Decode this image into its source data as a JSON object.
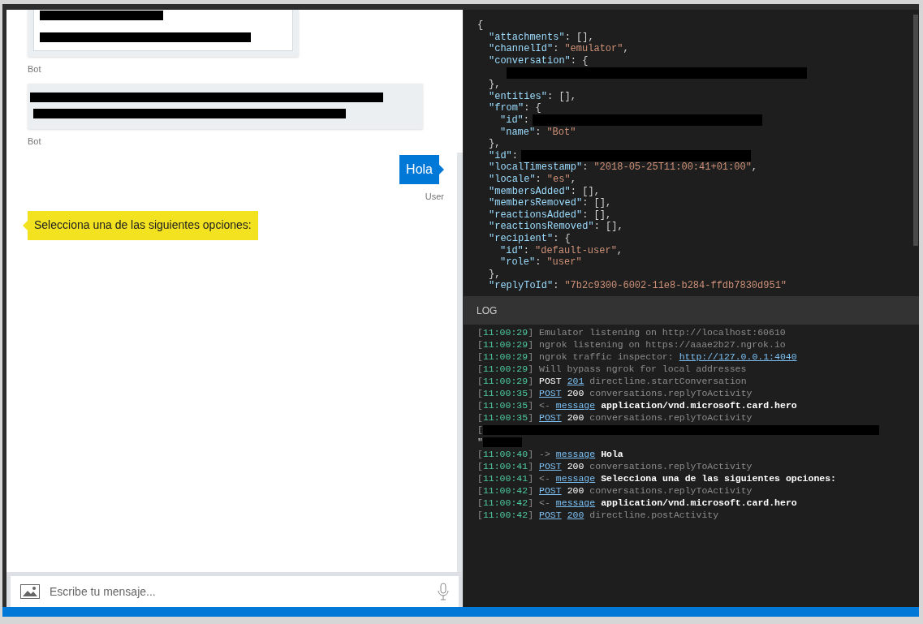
{
  "chat": {
    "messages": [
      {
        "kind": "card",
        "sender": "Bot",
        "selected": false
      },
      {
        "kind": "redacted",
        "sender": "Bot",
        "selected": false
      },
      {
        "kind": "user-text",
        "text": "Hola",
        "sender": "User",
        "selected": false
      },
      {
        "kind": "bot-text",
        "text": "Selecciona una de las siguientes opciones:",
        "selected": true
      }
    ],
    "input": {
      "placeholder": "Escribe tu mensaje..."
    }
  },
  "inspector": {
    "lines": [
      {
        "t": [
          {
            "kind": "punct",
            "text": "{"
          }
        ],
        "children": [
          {
            "t": [
              {
                "kind": "key",
                "text": "\"attachments\""
              },
              {
                "kind": "punct",
                "text": ": [],"
              }
            ]
          },
          {
            "t": [
              {
                "kind": "key",
                "text": "\"channelId\""
              },
              {
                "kind": "punct",
                "text": ":"
              },
              {
                "kind": "string",
                "text": "\"emulator\""
              },
              {
                "kind": "punct",
                "text": ","
              }
            ]
          },
          {
            "t": [
              {
                "kind": "key",
                "text": "\"conversation\""
              },
              {
                "kind": "punct",
                "text": ": {"
              }
            ],
            "close": [
              {
                "kind": "punct",
                "text": "},"
              }
            ],
            "children": [
              {
                "t": [
                  {
                    "kind": "redacted-long"
                  }
                ]
              }
            ]
          },
          {
            "t": [
              {
                "kind": "key",
                "text": "\"entities\""
              },
              {
                "kind": "punct",
                "text": ": [],"
              }
            ]
          },
          {
            "t": [
              {
                "kind": "key",
                "text": "\"from\""
              },
              {
                "kind": "punct",
                "text": ": {"
              }
            ],
            "close": [
              {
                "kind": "punct",
                "text": "},"
              }
            ],
            "children": [
              {
                "t": [
                  {
                    "kind": "key",
                    "text": "\"id\""
                  },
                  {
                    "kind": "punct",
                    "text": ":"
                  },
                  {
                    "kind": "redacted"
                  }
                ]
              },
              {
                "t": [
                  {
                    "kind": "key",
                    "text": "\"name\""
                  },
                  {
                    "kind": "punct",
                    "text": ":"
                  },
                  {
                    "kind": "string",
                    "text": "\"Bot\""
                  }
                ]
              }
            ]
          },
          {
            "t": [
              {
                "kind": "key",
                "text": "\"id\""
              },
              {
                "kind": "punct",
                "text": ":"
              },
              {
                "kind": "redacted"
              }
            ]
          },
          {
            "t": [
              {
                "kind": "key",
                "text": "\"localTimestamp\""
              },
              {
                "kind": "punct",
                "text": ":"
              },
              {
                "kind": "string",
                "text": "\"2018-05-25T11:00:41+01:00\""
              },
              {
                "kind": "punct",
                "text": ","
              }
            ]
          },
          {
            "t": [
              {
                "kind": "key",
                "text": "\"locale\""
              },
              {
                "kind": "punct",
                "text": ":"
              },
              {
                "kind": "string",
                "text": "\"es\""
              },
              {
                "kind": "punct",
                "text": ","
              }
            ]
          },
          {
            "t": [
              {
                "kind": "key",
                "text": "\"membersAdded\""
              },
              {
                "kind": "punct",
                "text": ": [],"
              }
            ]
          },
          {
            "t": [
              {
                "kind": "key",
                "text": "\"membersRemoved\""
              },
              {
                "kind": "punct",
                "text": ": [],"
              }
            ]
          },
          {
            "t": [
              {
                "kind": "key",
                "text": "\"reactionsAdded\""
              },
              {
                "kind": "punct",
                "text": ": [],"
              }
            ]
          },
          {
            "t": [
              {
                "kind": "key",
                "text": "\"reactionsRemoved\""
              },
              {
                "kind": "punct",
                "text": ": [],"
              }
            ]
          },
          {
            "t": [
              {
                "kind": "key",
                "text": "\"recipient\""
              },
              {
                "kind": "punct",
                "text": ": {"
              }
            ],
            "close": [
              {
                "kind": "punct",
                "text": "},"
              }
            ],
            "children": [
              {
                "t": [
                  {
                    "kind": "key",
                    "text": "\"id\""
                  },
                  {
                    "kind": "punct",
                    "text": ":"
                  },
                  {
                    "kind": "string",
                    "text": "\"default-user\""
                  },
                  {
                    "kind": "punct",
                    "text": ","
                  }
                ]
              },
              {
                "t": [
                  {
                    "kind": "key",
                    "text": "\"role\""
                  },
                  {
                    "kind": "punct",
                    "text": ":"
                  },
                  {
                    "kind": "string",
                    "text": "\"user\""
                  }
                ]
              }
            ]
          },
          {
            "t": [
              {
                "kind": "key",
                "text": "\"replyToId\""
              },
              {
                "kind": "punct",
                "text": ":"
              },
              {
                "kind": "string",
                "text": "\"7b2c9300-6002-11e8-b284-ffdb7830d951\""
              }
            ]
          }
        ]
      }
    ]
  },
  "log": {
    "title": "LOG",
    "entries": [
      {
        "kind": "line",
        "open": "[",
        "time": "11:00:29",
        "close": "]",
        "parts": [
          {
            "kind": "dim",
            "text": "Emulator listening on http://localhost:60610"
          }
        ]
      },
      {
        "kind": "line",
        "open": "[",
        "time": "11:00:29",
        "close": "]",
        "parts": [
          {
            "kind": "dim",
            "text": "ngrok listening on https://aaae2b27.ngrok.io"
          }
        ]
      },
      {
        "kind": "line",
        "open": "[",
        "time": "11:00:29",
        "close": "]",
        "parts": [
          {
            "kind": "dim",
            "text": "ngrok traffic inspector:"
          },
          {
            "kind": "link",
            "text": "http://127.0.0.1:4040"
          }
        ]
      },
      {
        "kind": "line",
        "open": "[",
        "time": "11:00:29",
        "close": "]",
        "parts": [
          {
            "kind": "dim",
            "text": "Will bypass ngrok for local addresses"
          }
        ]
      },
      {
        "kind": "line",
        "open": "[",
        "time": "11:00:29",
        "close": "]",
        "parts": [
          {
            "kind": "text",
            "text": "POST"
          },
          {
            "kind": "link",
            "text": "201"
          },
          {
            "kind": "dim",
            "text": "directline.startConversation"
          }
        ]
      },
      {
        "kind": "line",
        "open": "[",
        "time": "11:00:35",
        "close": "]",
        "parts": [
          {
            "kind": "link",
            "text": "POST"
          },
          {
            "kind": "text",
            "text": "200"
          },
          {
            "kind": "dim",
            "text": "conversations.replyToActivity"
          }
        ]
      },
      {
        "kind": "line",
        "open": "[",
        "time": "11:00:35",
        "close": "]",
        "parts": [
          {
            "kind": "dim",
            "text": "<-"
          },
          {
            "kind": "link",
            "text": "message"
          },
          {
            "kind": "bold",
            "text": "application/vnd.microsoft.card.hero"
          }
        ]
      },
      {
        "kind": "line",
        "open": "[",
        "time": "11:00:35",
        "close": "]",
        "parts": [
          {
            "kind": "link",
            "text": "POST"
          },
          {
            "kind": "text",
            "text": "200"
          },
          {
            "kind": "dim",
            "text": "conversations.replyToActivity"
          }
        ]
      },
      {
        "kind": "redacted",
        "lead": "[",
        "tail": "\""
      },
      {
        "kind": "line",
        "open": "[",
        "time": "11:00:40",
        "close": "]",
        "parts": [
          {
            "kind": "dim",
            "text": "->"
          },
          {
            "kind": "link",
            "text": "message"
          },
          {
            "kind": "bold",
            "text": "Hola"
          }
        ]
      },
      {
        "kind": "line",
        "open": "[",
        "time": "11:00:41",
        "close": "]",
        "parts": [
          {
            "kind": "link",
            "text": "POST"
          },
          {
            "kind": "text",
            "text": "200"
          },
          {
            "kind": "dim",
            "text": "conversations.replyToActivity"
          }
        ]
      },
      {
        "kind": "line",
        "open": "[",
        "time": "11:00:41",
        "close": "]",
        "parts": [
          {
            "kind": "dim",
            "text": "<-"
          },
          {
            "kind": "link",
            "text": "message"
          },
          {
            "kind": "bold",
            "text": "Selecciona una de las siguientes opciones:"
          }
        ]
      },
      {
        "kind": "line",
        "open": "[",
        "time": "11:00:42",
        "close": "]",
        "parts": [
          {
            "kind": "link",
            "text": "POST"
          },
          {
            "kind": "text",
            "text": "200"
          },
          {
            "kind": "dim",
            "text": "conversations.replyToActivity"
          }
        ]
      },
      {
        "kind": "line",
        "open": "[",
        "time": "11:00:42",
        "close": "]",
        "parts": [
          {
            "kind": "dim",
            "text": "<-"
          },
          {
            "kind": "link",
            "text": "message"
          },
          {
            "kind": "bold",
            "text": "application/vnd.microsoft.card.hero"
          }
        ]
      },
      {
        "kind": "line",
        "open": "[",
        "time": "11:00:42",
        "close": "]",
        "parts": [
          {
            "kind": "link",
            "text": "POST"
          },
          {
            "kind": "link",
            "text": "200"
          },
          {
            "kind": "dim",
            "text": "directline.postActivity"
          }
        ]
      }
    ]
  }
}
